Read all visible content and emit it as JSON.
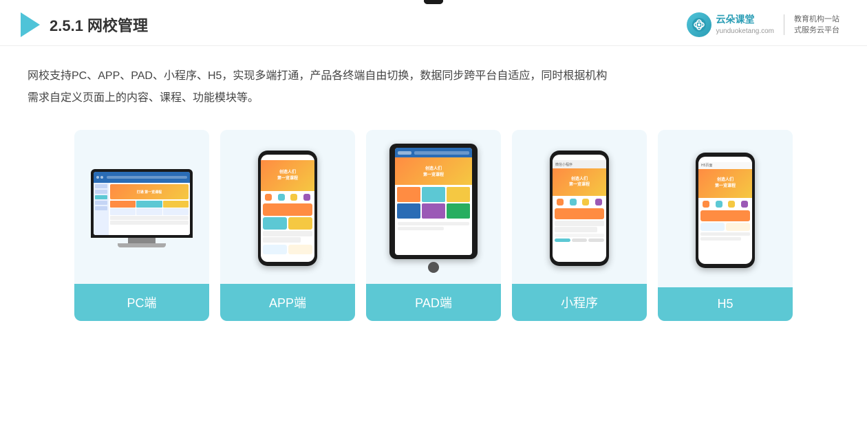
{
  "header": {
    "title_prefix": "2.5.1 ",
    "title_bold": "网校管理",
    "brand_name": "云朵课堂",
    "brand_domain": "yunduoketang.com",
    "brand_slogan_line1": "教育机构一站",
    "brand_slogan_line2": "式服务云平台"
  },
  "description": {
    "text_line1": "网校支持PC、APP、PAD、小程序、H5，实现多端打通，产品各终端自由切换，数据同步跨平台自适应，同时根据机构",
    "text_line2": "需求自定义页面上的内容、课程、功能模块等。"
  },
  "cards": [
    {
      "id": "pc",
      "label": "PC端"
    },
    {
      "id": "app",
      "label": "APP端"
    },
    {
      "id": "pad",
      "label": "PAD端"
    },
    {
      "id": "mini",
      "label": "小程序"
    },
    {
      "id": "h5",
      "label": "H5"
    }
  ],
  "colors": {
    "teal": "#5cc8d4",
    "teal_bg": "#e8f5f8",
    "card_bg": "#edf6f9"
  }
}
